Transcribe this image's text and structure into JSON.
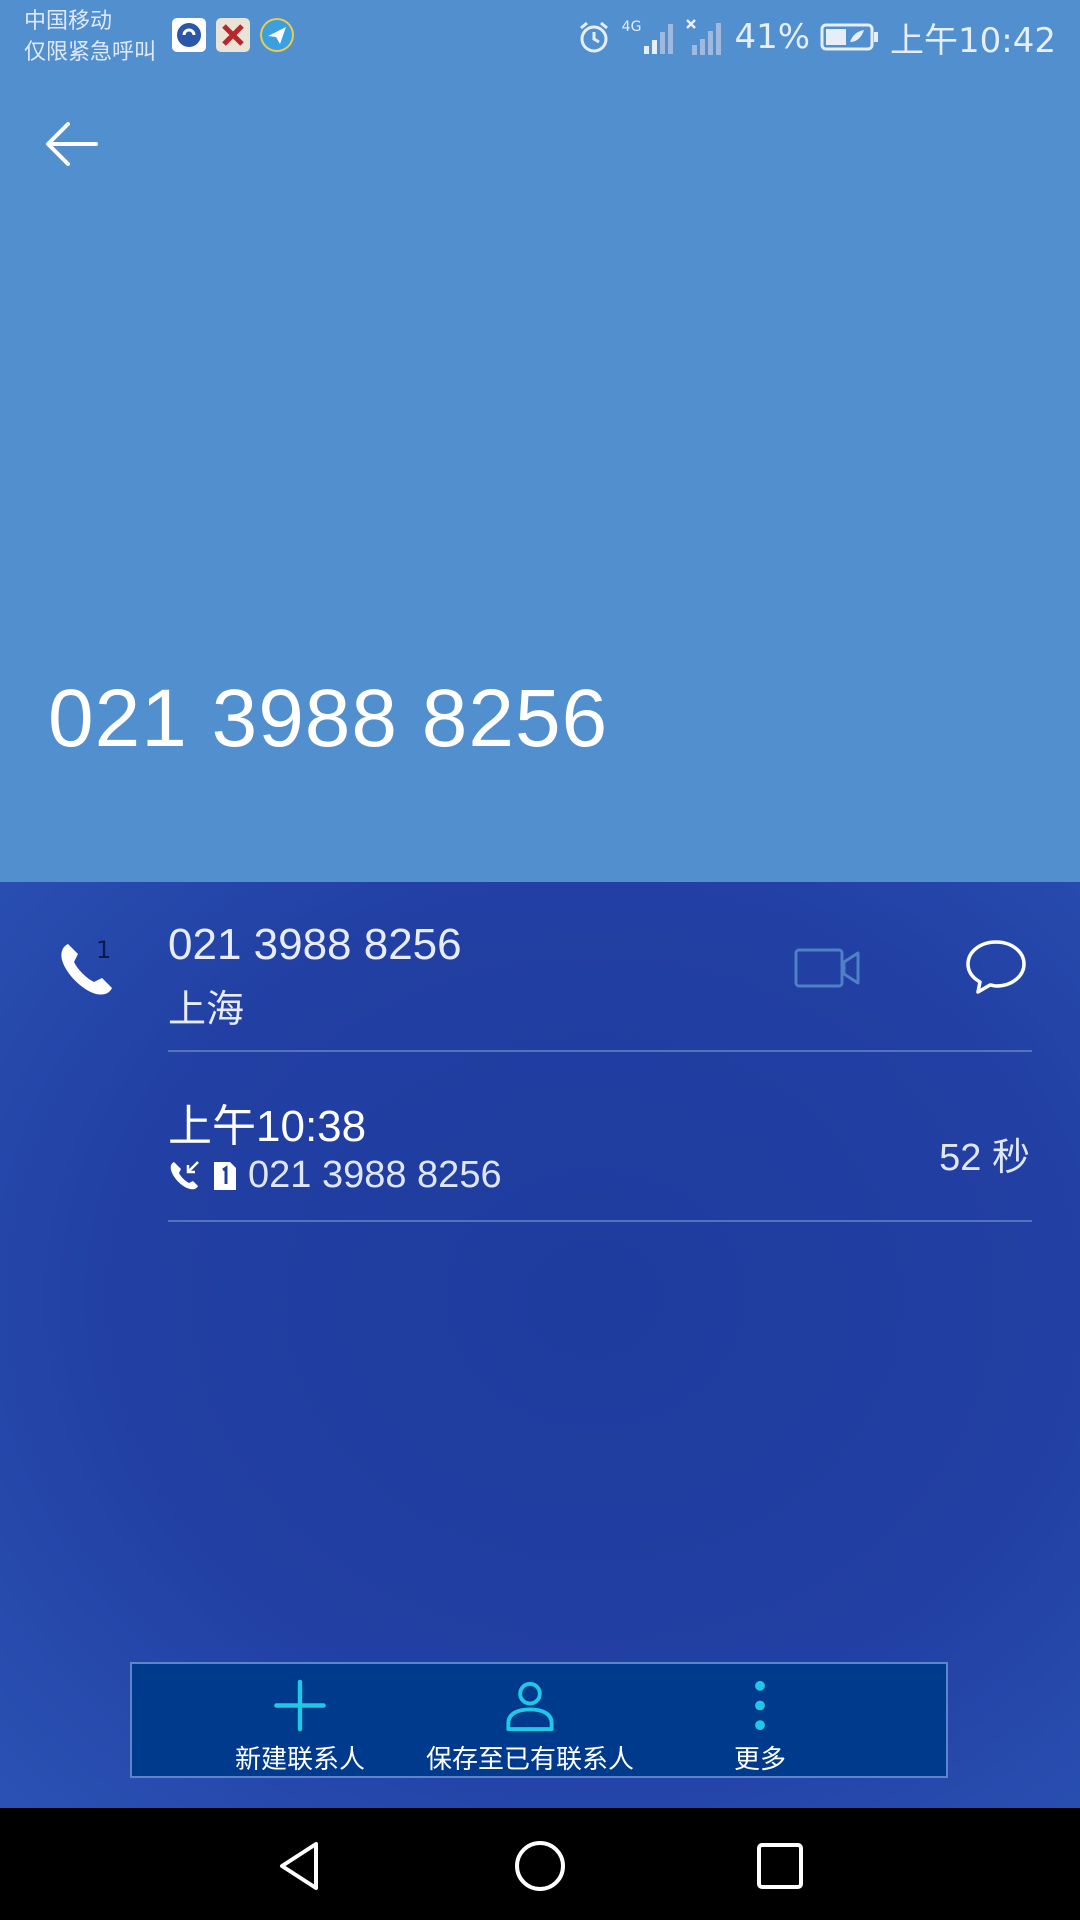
{
  "status_bar": {
    "carrier_line1": "中国移动",
    "carrier_line2": "仅限紧急呼叫",
    "battery": "41%",
    "time": "上午10:42",
    "network": "4G"
  },
  "header": {
    "phone_number": "021 3988 8256"
  },
  "contact": {
    "sim": "1",
    "number": "021 3988 8256",
    "location": "上海"
  },
  "call_log": {
    "time": "上午10:38",
    "sim": "1",
    "number": "021 3988 8256",
    "duration": "52 秒"
  },
  "actions": {
    "new_contact": "新建联系人",
    "save_existing": "保存至已有联系人",
    "more": "更多"
  },
  "colors": {
    "header_bg": "#518fcf",
    "body_bg": "#1f3f9e",
    "accent": "#1ec8e6"
  }
}
